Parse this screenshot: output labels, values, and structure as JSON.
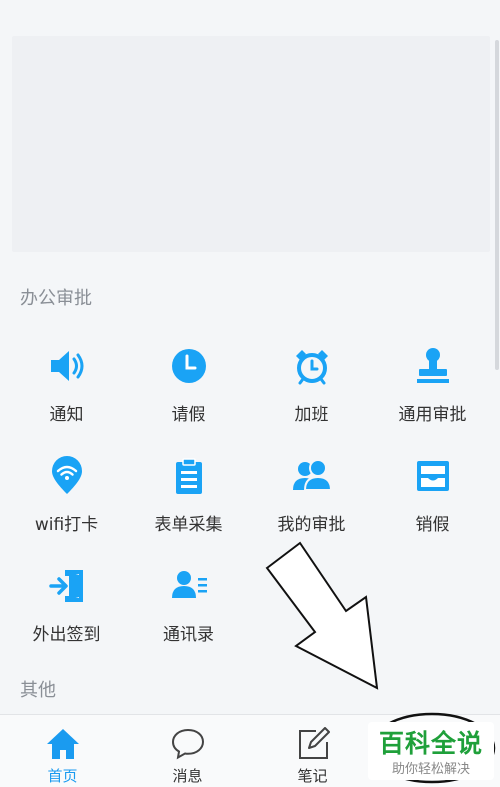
{
  "sections": {
    "office": "办公审批",
    "other": "其他"
  },
  "grid": [
    {
      "label": "通知",
      "icon": "speaker-icon"
    },
    {
      "label": "请假",
      "icon": "clock-icon"
    },
    {
      "label": "加班",
      "icon": "alarm-clock-icon"
    },
    {
      "label": "通用审批",
      "icon": "stamp-icon"
    },
    {
      "label": "wifi打卡",
      "icon": "wifi-pin-icon"
    },
    {
      "label": "表单采集",
      "icon": "clipboard-icon"
    },
    {
      "label": "我的审批",
      "icon": "users-icon"
    },
    {
      "label": "销假",
      "icon": "inbox-icon"
    },
    {
      "label": "外出签到",
      "icon": "exit-door-icon"
    },
    {
      "label": "通讯录",
      "icon": "contact-card-icon"
    }
  ],
  "tabs": [
    {
      "label": "首页",
      "icon": "home-icon",
      "active": true
    },
    {
      "label": "消息",
      "icon": "chat-bubble-icon",
      "active": false
    },
    {
      "label": "笔记",
      "icon": "edit-note-icon",
      "active": false
    }
  ],
  "watermark": {
    "title": "百科全说",
    "subtitle": "助你轻松解决"
  },
  "colors": {
    "accent": "#1a9bf0",
    "icon_blue": "#1aa3f5",
    "watermark_green": "#1fa03a"
  }
}
